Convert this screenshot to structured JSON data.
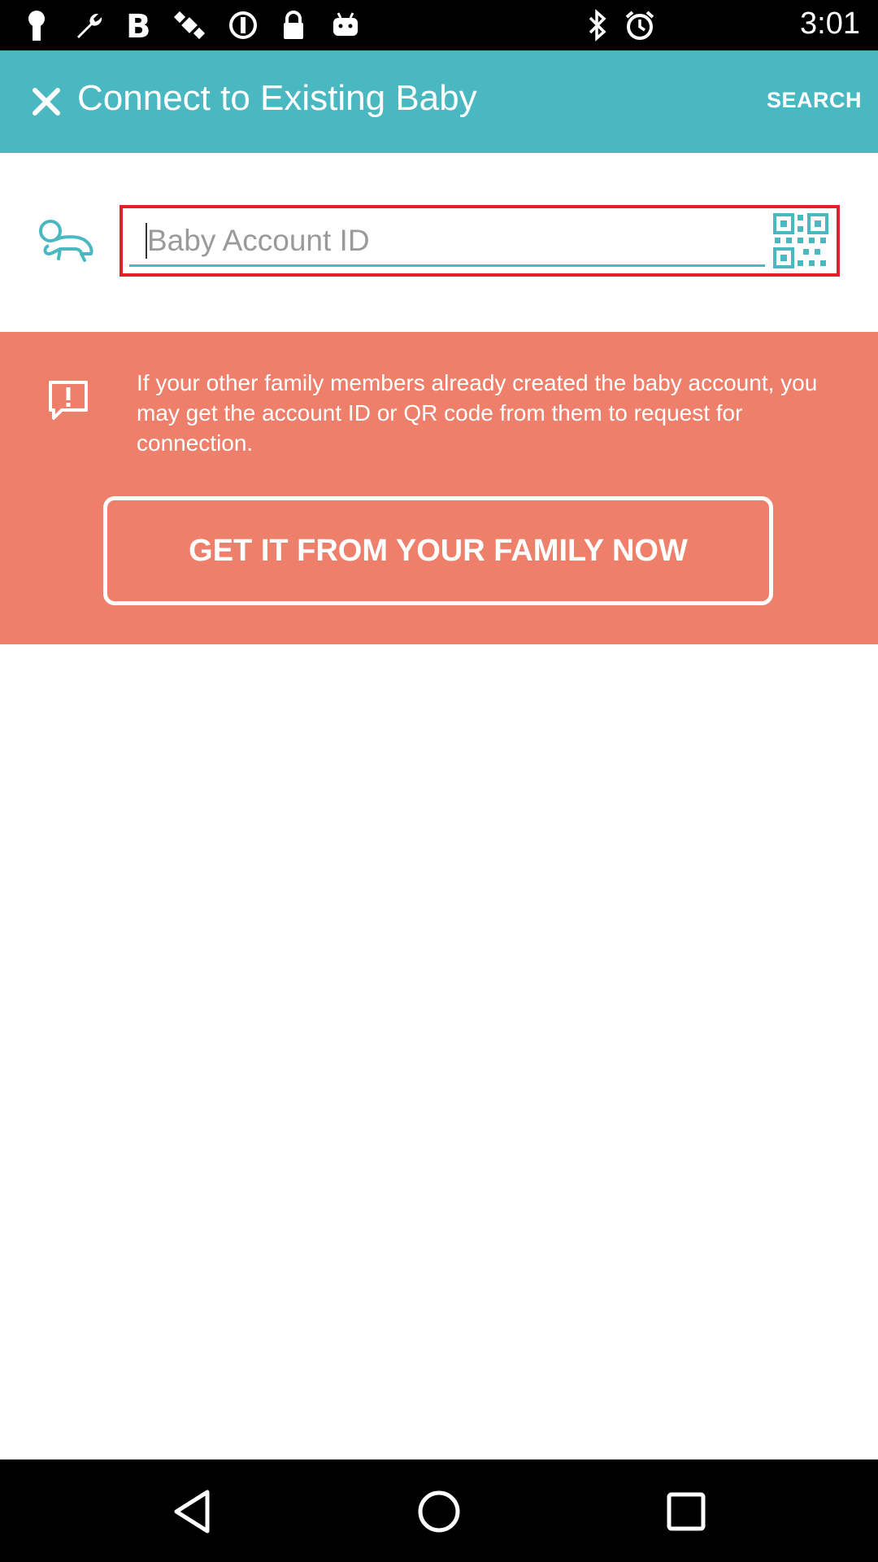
{
  "status_bar": {
    "time": "3:01",
    "icons": [
      "keyhole-icon",
      "wrench-icon",
      "bold-b-icon",
      "fake-gps-satellite-icon",
      "blocked-circle-icon",
      "lock-icon",
      "android-icon",
      "bluetooth-icon",
      "alarm-icon"
    ]
  },
  "app_bar": {
    "title": "Connect to Existing Baby",
    "search_label": "SEARCH"
  },
  "account_input": {
    "placeholder": "Baby Account ID",
    "value": ""
  },
  "info_panel": {
    "message": "If your other family members already created the baby account, you may get the account ID or QR code from them to request for connection.",
    "button_label": "GET IT FROM YOUR FAMILY NOW"
  },
  "colors": {
    "accent_teal": "#4ab8c1",
    "panel_salmon": "#ee806b",
    "focus_red": "#e61e2a"
  },
  "nav_bar": {
    "buttons": [
      "back-icon",
      "home-icon",
      "recents-icon"
    ]
  }
}
